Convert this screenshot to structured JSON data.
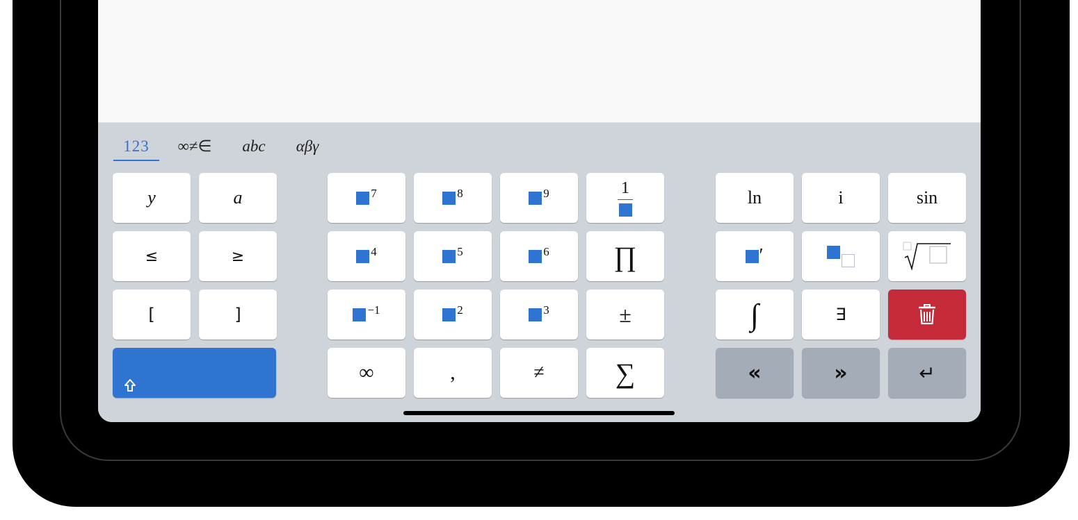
{
  "tabs": [
    {
      "label": "123",
      "active": true
    },
    {
      "label": "∞≠∈",
      "active": false
    },
    {
      "label": "abc",
      "active": false
    },
    {
      "label": "αβγ",
      "active": false
    }
  ],
  "keys": {
    "y": "y",
    "a": "a",
    "le": "≤",
    "ge": "≥",
    "lbracket": "[",
    "rbracket": "]",
    "pow7": "7",
    "pow8": "8",
    "pow9": "9",
    "frac_num": "1",
    "pow4": "4",
    "pow5": "5",
    "pow6": "6",
    "prod": "∏",
    "powm1": "−1",
    "pow2": "2",
    "pow3": "3",
    "pm": "±",
    "infinity": "∞",
    "comma": ",",
    "neq": "≠",
    "sum": "∑",
    "ln": "ln",
    "i": "i",
    "sin": "sin",
    "prime": "′",
    "integral": "∫",
    "exists": "∃",
    "left": "«",
    "right": "»",
    "enter": "↵"
  },
  "colors": {
    "accent": "#2f74d0",
    "delete": "#c42a37",
    "keyboard_bg": "#cfd3da",
    "action_key": "#a4acb8"
  }
}
